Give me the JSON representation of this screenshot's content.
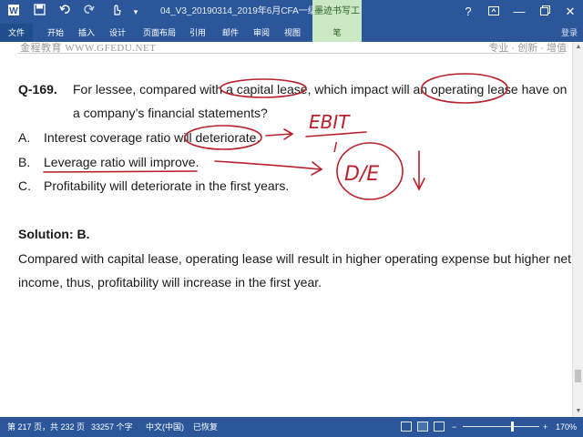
{
  "titlebar": {
    "doc_title": "04_V3_20190314_2019年6月CFA一级百题预...",
    "context_tab": "墨迹书写工具",
    "icons": [
      "word-app-icon",
      "save-icon",
      "undo-icon",
      "redo-icon",
      "touch-mode-icon",
      "customize-icon"
    ]
  },
  "ribbon": {
    "tabs": [
      "文件",
      "开始",
      "插入",
      "设计",
      "页面布局",
      "引用",
      "邮件",
      "审阅",
      "视图",
      "笔"
    ],
    "sub_label": "登录"
  },
  "document": {
    "header_left": "金程教育  WWW.GFEDU.NET",
    "header_right": "专业 · 创新 · 增值",
    "question": {
      "number": "Q-169.",
      "text_line1": "For lessee, compared with a capital lease, which impact will an operating lease have on",
      "text_line2": "a company’s financial statements?"
    },
    "options": [
      {
        "letter": "A.",
        "text": "Interest coverage ratio will deteriorate."
      },
      {
        "letter": "B.",
        "text": "Leverage ratio will improve."
      },
      {
        "letter": "C.",
        "text": "Profitability will deteriorate in the first years."
      }
    ],
    "solution_label": "Solution: B.",
    "solution_line1": "Compared with capital lease, operating lease will result in higher operating expense but higher net",
    "solution_line2": "income, thus, profitability will increase in the first year.",
    "annotations": {
      "ebit_over": "EBIT",
      "ebit_under": "I",
      "de_label": "D/E",
      "arrow_down": "↓"
    }
  },
  "statusbar": {
    "page": "第 217 页，共 232 页",
    "words": "33257 个字",
    "language": "中文(中国)",
    "recovered": "已恢复",
    "zoom": "170%",
    "zoom_fraction": 0.64
  }
}
